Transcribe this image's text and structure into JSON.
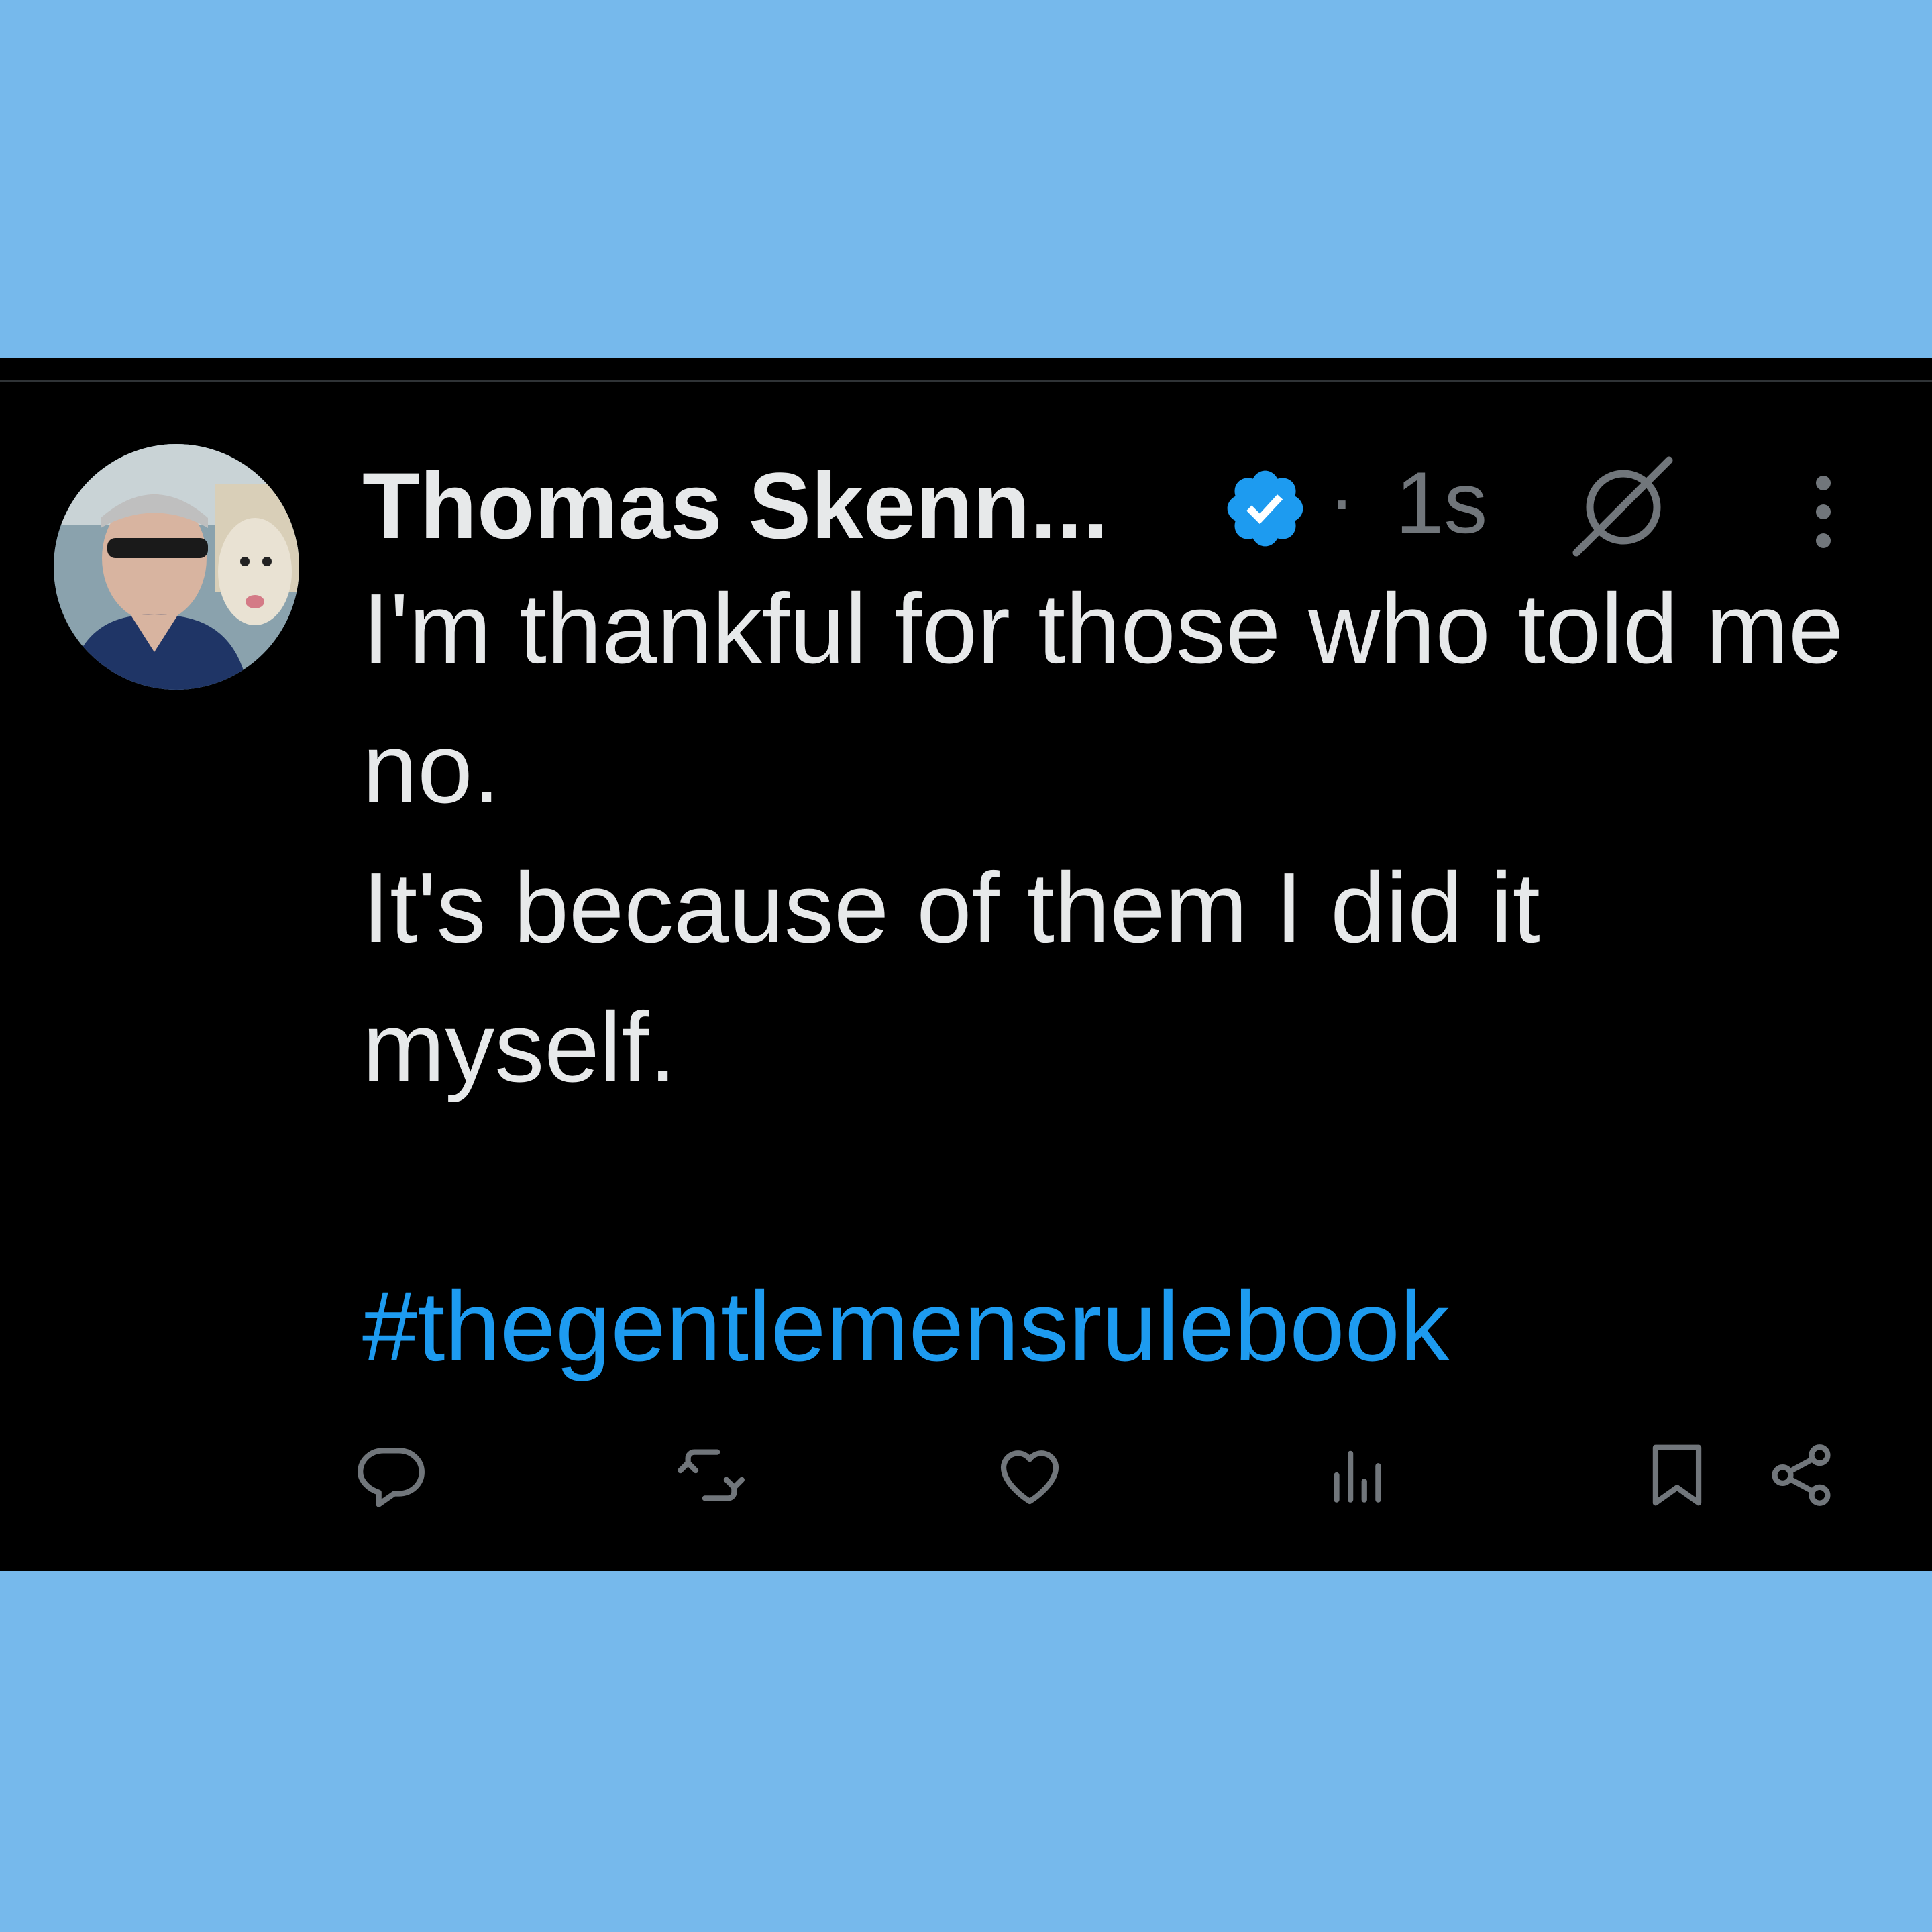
{
  "tweet": {
    "author_name": "Thomas Skenn...",
    "timestamp": "1s",
    "separator": "·",
    "text_lines": [
      "I'm thankful for those who told me no.",
      "It's because of them I did it myself."
    ],
    "hashtag": "#thegentlemensrulebook"
  },
  "icons": {
    "verified": "verified-badge-icon",
    "grok": "grok-icon",
    "more": "more-vertical-icon",
    "reply": "reply-icon",
    "repost": "repost-icon",
    "like": "like-icon",
    "views": "views-icon",
    "bookmark": "bookmark-icon",
    "share": "share-icon"
  },
  "colors": {
    "background": "#76b9ec",
    "card": "#000000",
    "text": "#e7e9ea",
    "muted": "#71767b",
    "accent": "#1d9bf0"
  }
}
